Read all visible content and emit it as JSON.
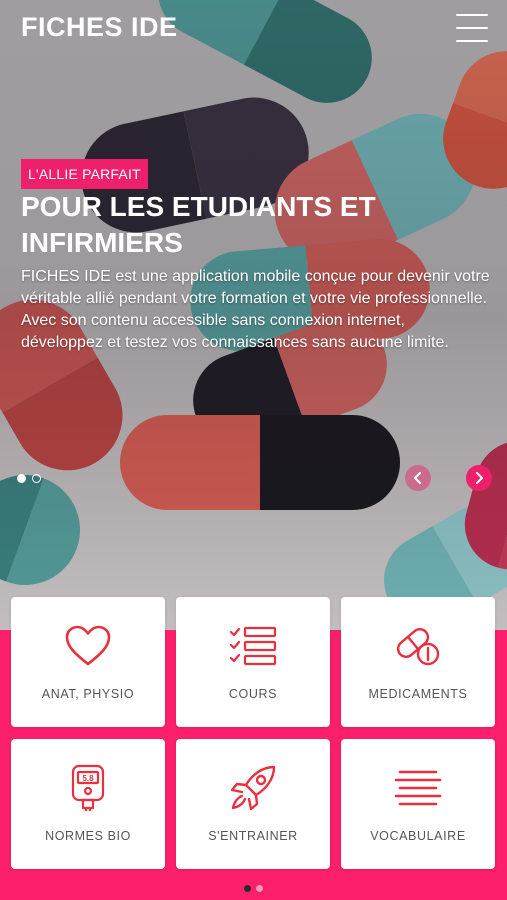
{
  "app": {
    "title": "FICHES IDE"
  },
  "hero": {
    "badge": "L'ALLIE PARFAIT",
    "headline": "POUR LES ETUDIANTS ET INFIRMIERS",
    "description": "FICHES IDE est une application mobile conçue pour devenir votre véritable allié pendant votre formation et votre vie professionnelle. Avec son contenu accessible sans connexion internet, développez et testez vos connaissances sans aucune limite.",
    "slides_total": 2,
    "current_slide": 1
  },
  "tiles": [
    {
      "label": "ANAT, PHYSIO",
      "icon": "heart-icon"
    },
    {
      "label": "COURS",
      "icon": "checklist-icon"
    },
    {
      "label": "MEDICAMENTS",
      "icon": "pill-icon"
    },
    {
      "label": "NORMES BIO",
      "icon": "glucometer-icon"
    },
    {
      "label": "S'ENTRAINER",
      "icon": "rocket-icon"
    },
    {
      "label": "VOCABULAIRE",
      "icon": "text-lines-icon"
    }
  ],
  "pagination": {
    "pages": 2,
    "current": 1
  },
  "colors": {
    "accent": "#ee1f6b",
    "grid_background": "#fb1f6c",
    "icon": "#e8303f"
  }
}
